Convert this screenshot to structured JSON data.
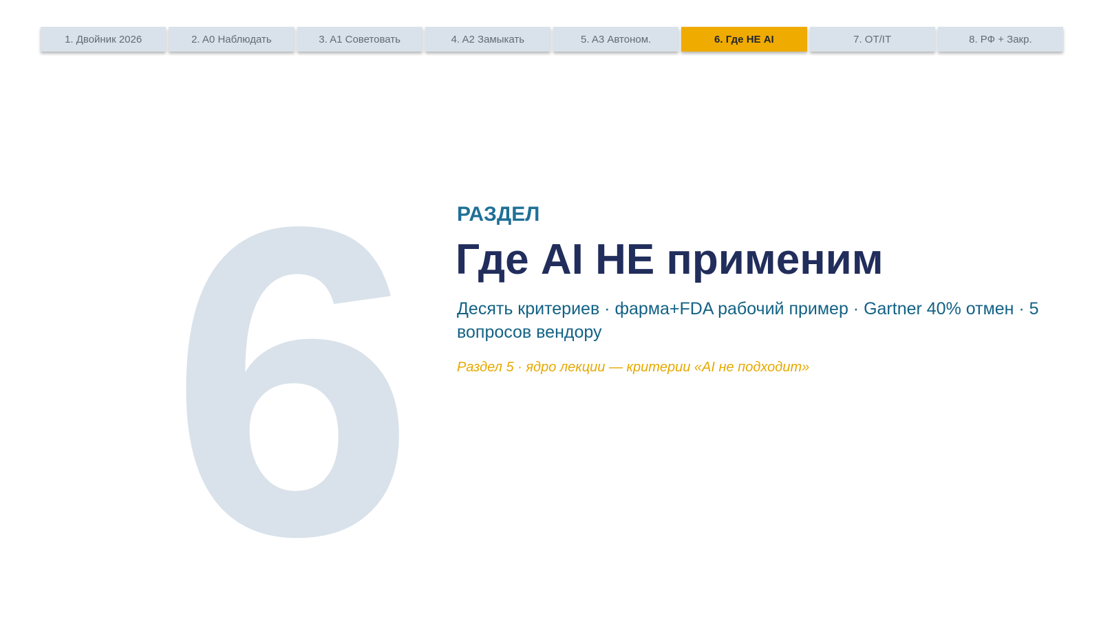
{
  "nav": {
    "tabs": [
      {
        "label": "1. Двойник 2026",
        "active": false
      },
      {
        "label": "2. A0 Наблюдать",
        "active": false
      },
      {
        "label": "3. A1 Советовать",
        "active": false
      },
      {
        "label": "4. A2 Замыкать",
        "active": false
      },
      {
        "label": "5. A3 Автоном.",
        "active": false
      },
      {
        "label": "6. Где НЕ AI",
        "active": true
      },
      {
        "label": "7. OT/IT",
        "active": false
      },
      {
        "label": "8. РФ + Закр.",
        "active": false
      }
    ]
  },
  "section": {
    "number": "6",
    "label": "РАЗДЕЛ",
    "title": "Где AI НЕ применим",
    "subtitle": "Десять критериев · фарма+FDA рабочий пример · Gartner 40% отмен · 5 вопросов вендору",
    "note": "Раздел 5 · ядро лекции — критерии «AI не подходит»"
  },
  "colors": {
    "active_tab": "#f0ab00",
    "inactive_tab": "#d9e2ea",
    "title": "#212d5b",
    "section_label": "#1f7096",
    "subtitle": "#136285",
    "note": "#e6a900",
    "big_number": "#d9e2ea"
  }
}
